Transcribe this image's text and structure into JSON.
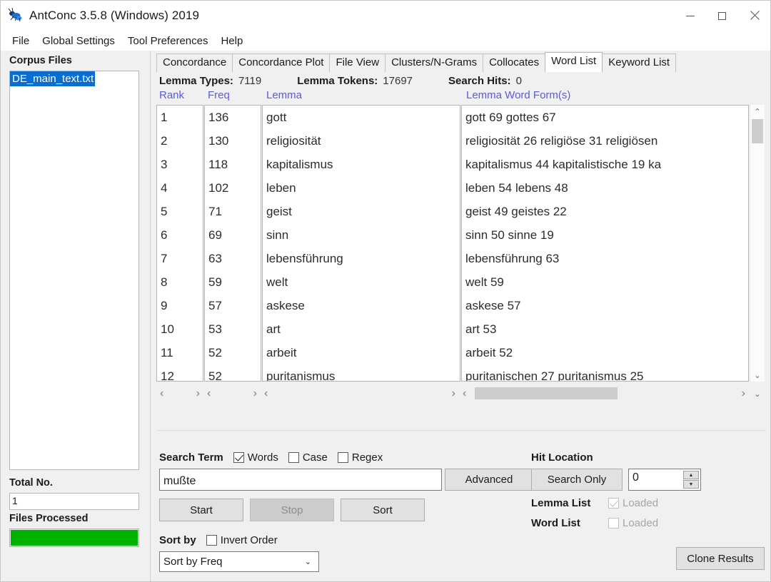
{
  "window": {
    "title": "AntConc 3.5.8 (Windows) 2019",
    "icon": "ant-icon",
    "minimize_label": "—",
    "maximize_label": "□",
    "close_label": "✕"
  },
  "menu": {
    "items": [
      {
        "label": "File"
      },
      {
        "label": "Global Settings"
      },
      {
        "label": "Tool Preferences"
      },
      {
        "label": "Help"
      }
    ]
  },
  "sidebar": {
    "corpus_files_label": "Corpus Files",
    "files": [
      {
        "name": "DE_main_text.txt",
        "selected": true
      }
    ],
    "total_no_label": "Total No.",
    "total_no_value": "1",
    "files_processed_label": "Files Processed",
    "progress_percent": 100,
    "progress_color": "#00b200"
  },
  "tabs": [
    {
      "label": "Concordance",
      "active": false
    },
    {
      "label": "Concordance Plot",
      "active": false
    },
    {
      "label": "File View",
      "active": false
    },
    {
      "label": "Clusters/N-Grams",
      "active": false
    },
    {
      "label": "Collocates",
      "active": false
    },
    {
      "label": "Word List",
      "active": true
    },
    {
      "label": "Keyword List",
      "active": false
    }
  ],
  "stats": {
    "lemma_types_label": "Lemma Types:",
    "lemma_types_value": "7119",
    "lemma_tokens_label": "Lemma Tokens:",
    "lemma_tokens_value": "17697",
    "search_hits_label": "Search Hits:",
    "search_hits_value": "0"
  },
  "table": {
    "headers": [
      "Rank",
      "Freq",
      "Lemma",
      "Lemma Word Form(s)"
    ],
    "header_color": "#5b5bdd",
    "rows": [
      {
        "rank": "1",
        "freq": "136",
        "lemma": "gott",
        "forms": "gott 69 gottes 67"
      },
      {
        "rank": "2",
        "freq": "130",
        "lemma": "religiosität",
        "forms": "religiosität 26 religiöse 31 religiösen"
      },
      {
        "rank": "3",
        "freq": "118",
        "lemma": "kapitalismus",
        "forms": "kapitalismus 44 kapitalistische 19 ka"
      },
      {
        "rank": "4",
        "freq": "102",
        "lemma": "leben",
        "forms": "leben 54 lebens 48"
      },
      {
        "rank": "5",
        "freq": "71",
        "lemma": "geist",
        "forms": "geist 49 geistes 22"
      },
      {
        "rank": "6",
        "freq": "69",
        "lemma": "sinn",
        "forms": "sinn 50 sinne 19"
      },
      {
        "rank": "7",
        "freq": "63",
        "lemma": "lebensführung",
        "forms": "lebensführung 63"
      },
      {
        "rank": "8",
        "freq": "59",
        "lemma": "welt",
        "forms": "welt 59"
      },
      {
        "rank": "9",
        "freq": "57",
        "lemma": "askese",
        "forms": "askese 57"
      },
      {
        "rank": "10",
        "freq": "53",
        "lemma": "art",
        "forms": "art 53"
      },
      {
        "rank": "11",
        "freq": "52",
        "lemma": "arbeit",
        "forms": "arbeit 52"
      },
      {
        "rank": "12",
        "freq": "52",
        "lemma": "puritanismus",
        "forms": "puritanischen 27 puritanismus 25"
      }
    ]
  },
  "scroll": {
    "up_arrow": "⌃",
    "down_arrow": "⌄",
    "left_arrow": "‹",
    "right_arrow": "›"
  },
  "controls": {
    "search_term_label": "Search Term",
    "words_label": "Words",
    "words_checked": true,
    "case_label": "Case",
    "case_checked": false,
    "regex_label": "Regex",
    "regex_checked": false,
    "search_value": "mußte",
    "search_placeholder": "",
    "advanced_label": "Advanced",
    "start_label": "Start",
    "stop_label": "Stop",
    "stop_disabled": true,
    "sort_label": "Sort",
    "sort_by_label": "Sort by",
    "invert_order_label": "Invert Order",
    "invert_order_checked": false,
    "sort_select_value": "Sort by Freq",
    "sort_select_chevron": "⌄",
    "hit_location_label": "Hit Location",
    "search_only_label": "Search Only",
    "hit_location_value": "0",
    "spin_up": "▲",
    "spin_down": "▼",
    "lemma_list_label": "Lemma List",
    "lemma_list_status": "Loaded",
    "lemma_list_checked": true,
    "word_list_label": "Word List",
    "word_list_status": "Loaded",
    "word_list_checked": false,
    "clone_results_label": "Clone Results"
  }
}
